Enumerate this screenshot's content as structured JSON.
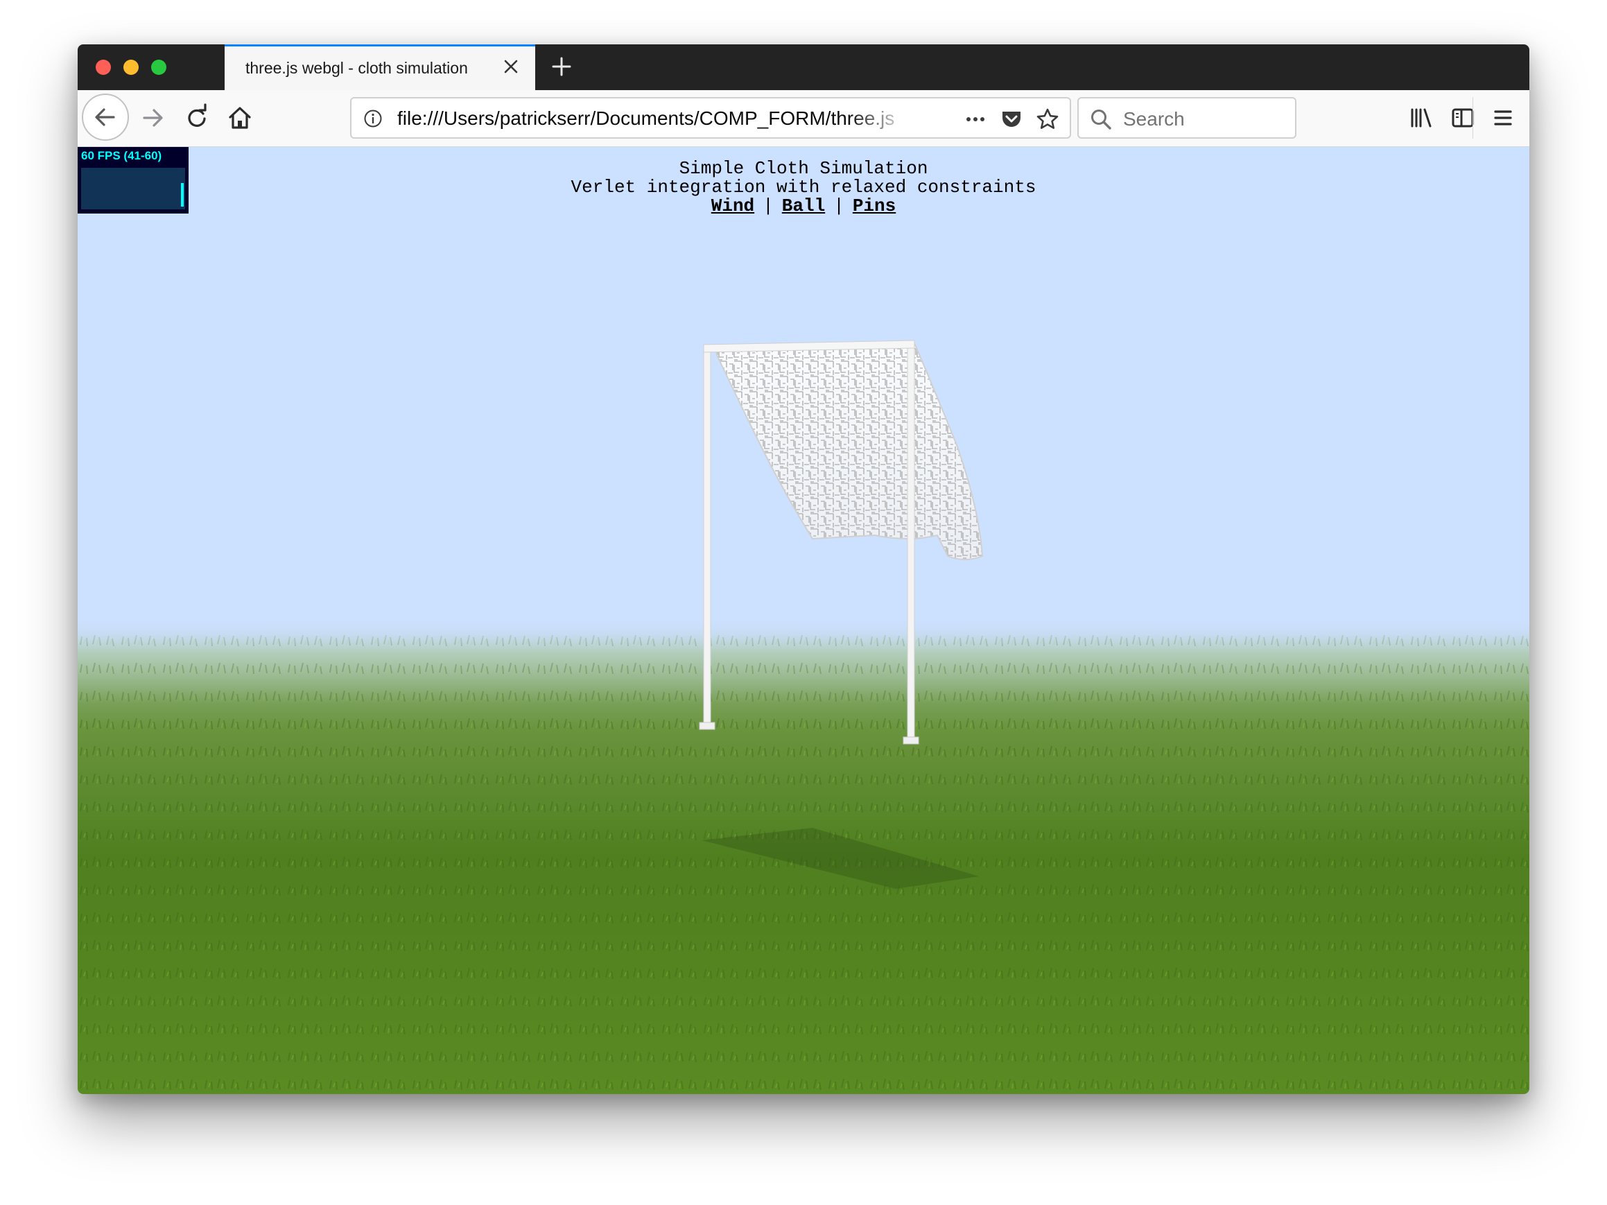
{
  "browser": {
    "tab": {
      "title": "three.js webgl - cloth simulation",
      "close_icon": "close-icon"
    },
    "new_tab_icon": "plus-icon",
    "toolbar": {
      "back_icon": "arrow-left-icon",
      "forward_icon": "arrow-right-icon",
      "reload_icon": "reload-icon",
      "home_icon": "home-icon",
      "url": "file:///Users/patrickserr/Documents/COMP_FORM/three.js",
      "page_actions_icon": "more-horizontal-icon",
      "pocket_icon": "pocket-icon",
      "bookmark_icon": "star-icon",
      "search_placeholder": "Search",
      "library_icon": "library-icon",
      "sidebar_icon": "sidebar-icon",
      "menu_icon": "hamburger-menu-icon"
    }
  },
  "page": {
    "info": {
      "title": "Simple Cloth Simulation",
      "subtitle": "Verlet integration with relaxed constraints",
      "links": [
        {
          "label": "Wind"
        },
        {
          "label": "Ball"
        },
        {
          "label": "Pins"
        }
      ],
      "separator": "|"
    },
    "stats": {
      "fps_text": "60 FPS (41-60)"
    }
  },
  "colors": {
    "sky": "#cce0ff",
    "grass": "#4c7d1a",
    "tab_accent": "#0a84ff",
    "stats_text": "#00ffff",
    "stats_bg": "#00002a"
  }
}
